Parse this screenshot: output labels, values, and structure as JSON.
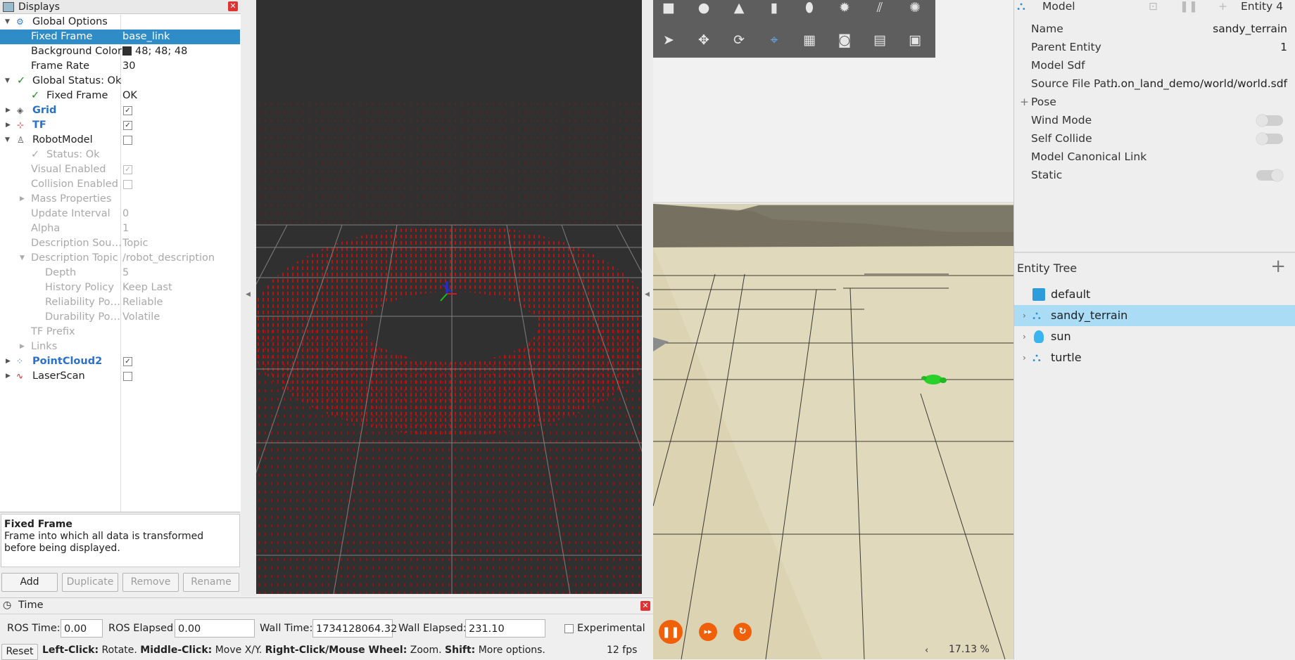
{
  "displays": {
    "title": "Displays",
    "close_icon": "close-icon",
    "rows": [
      {
        "label": "Global Options",
        "value": ""
      },
      {
        "label": "Fixed Frame",
        "value": "base_link"
      },
      {
        "label": "Background Color",
        "value": "48; 48; 48"
      },
      {
        "label": "Frame Rate",
        "value": "30"
      },
      {
        "label": "Global Status: Ok",
        "value": ""
      },
      {
        "label": "Fixed Frame",
        "value": "OK"
      },
      {
        "label": "Grid",
        "value": ""
      },
      {
        "label": "TF",
        "value": ""
      },
      {
        "label": "RobotModel",
        "value": ""
      },
      {
        "label": "Status: Ok",
        "value": ""
      },
      {
        "label": "Visual Enabled",
        "value": ""
      },
      {
        "label": "Collision Enabled",
        "value": ""
      },
      {
        "label": "Mass Properties",
        "value": ""
      },
      {
        "label": "Update Interval",
        "value": "0"
      },
      {
        "label": "Alpha",
        "value": "1"
      },
      {
        "label": "Description Sou…",
        "value": "Topic"
      },
      {
        "label": "Description Topic",
        "value": "/robot_description"
      },
      {
        "label": "Depth",
        "value": "5"
      },
      {
        "label": "History Policy",
        "value": "Keep Last"
      },
      {
        "label": "Reliability Po…",
        "value": "Reliable"
      },
      {
        "label": "Durability Po…",
        "value": "Volatile"
      },
      {
        "label": "TF Prefix",
        "value": ""
      },
      {
        "label": "Links",
        "value": ""
      },
      {
        "label": "PointCloud2",
        "value": ""
      },
      {
        "label": "LaserScan",
        "value": ""
      }
    ],
    "checks": {
      "grid": true,
      "tf": true,
      "robotmodel": false,
      "visual_enabled": true,
      "collision_enabled": false,
      "pointcloud2": true,
      "laserscan": false
    },
    "background_color_hex": "#303030",
    "selection_color": "#308cc6",
    "description": {
      "title": "Fixed Frame",
      "text": "Frame into which all data is transformed before being displayed."
    },
    "buttons": {
      "add": "Add",
      "duplicate": "Duplicate",
      "remove": "Remove",
      "rename": "Rename"
    }
  },
  "time": {
    "title": "Time",
    "ros_time_label": "ROS Time:",
    "ros_time": "0.00",
    "ros_elapsed_label": "ROS Elapsed:",
    "ros_elapsed": "0.00",
    "wall_time_label": "Wall Time:",
    "wall_time": "1734128064.32",
    "wall_elapsed_label": "Wall Elapsed:",
    "wall_elapsed": "231.10",
    "experimental": "Experimental",
    "reset": "Reset",
    "hint_left_b": "Left-Click:",
    "hint_left": " Rotate. ",
    "hint_mid_b": "Middle-Click:",
    "hint_mid": " Move X/Y. ",
    "hint_right_b": "Right-Click/Mouse Wheel:",
    "hint_right": " Zoom. ",
    "hint_shift_b": "Shift:",
    "hint_shift": " More options.",
    "fps": "12 fps"
  },
  "gazebo": {
    "toolbar_icons": [
      "box-icon",
      "sphere-icon",
      "cone-icon",
      "cylinder-icon",
      "capsule-icon",
      "point-light-icon",
      "directional-light-icon",
      "spot-light-icon",
      "select-icon",
      "translate-icon",
      "rotate-icon",
      "transform-control-icon",
      "grid-config-icon",
      "screenshot-icon",
      "copy-icon",
      "paste-icon"
    ],
    "rtf": "17.13 %",
    "component_inspector": {
      "header_label": "Model",
      "entity_label": "Entity 4",
      "rows": [
        {
          "key": "Name",
          "value": "sandy_terrain"
        },
        {
          "key": "Parent Entity",
          "value": "1"
        },
        {
          "key": "Model Sdf",
          "value": ""
        },
        {
          "key": "Source File Path",
          "value": "…on_land_demo/world/world.sdf"
        },
        {
          "key": "Pose",
          "value": ""
        },
        {
          "key": "Wind Mode",
          "value": ""
        },
        {
          "key": "Self Collide",
          "value": ""
        },
        {
          "key": "Model Canonical Link",
          "value": ""
        },
        {
          "key": "Static",
          "value": ""
        }
      ],
      "toggles": {
        "wind_mode": false,
        "self_collide": false,
        "static": true
      }
    },
    "entity_tree": {
      "title": "Entity Tree",
      "items": [
        "default",
        "sandy_terrain",
        "sun",
        "turtle"
      ],
      "selected": "sandy_terrain"
    },
    "accent_color": "#f06008",
    "selection_color": "#aadcf6"
  }
}
